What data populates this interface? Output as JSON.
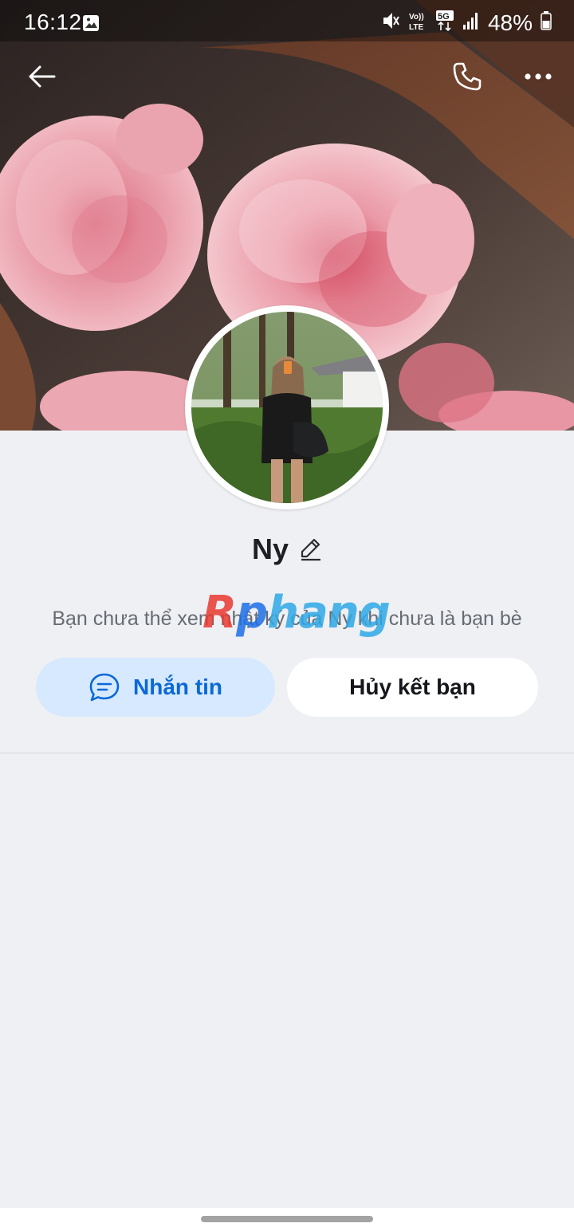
{
  "status_bar": {
    "time": "16:12",
    "battery_percent": "48%",
    "network_label": "5G",
    "volte_label": "Vo)) LTE",
    "icons": [
      "gallery-icon",
      "mute-icon",
      "volte-icon",
      "5g-icon",
      "signal-icon",
      "battery-icon"
    ]
  },
  "app_bar": {
    "icons": [
      "back-arrow-icon",
      "phone-icon",
      "more-options-icon"
    ]
  },
  "profile": {
    "name": "Ny",
    "diary_notice": "Bạn chưa thể xem nhật ký của Ny khi chưa là bạn bè"
  },
  "actions": {
    "message_label": "Nhắn tin",
    "unfriend_label": "Hủy kết bạn"
  },
  "watermark": {
    "part1": "R",
    "part2": "p",
    "part3": "hang"
  },
  "colors": {
    "accent": "#0b68d6",
    "message_button_bg": "#d6e9fe",
    "page_bg": "#eff0f4"
  }
}
